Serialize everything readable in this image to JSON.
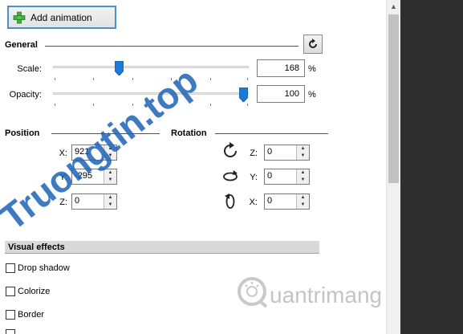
{
  "toolbar": {
    "add_animation_label": "Add animation"
  },
  "general": {
    "title": "General",
    "scale": {
      "label": "Scale:",
      "value": "168",
      "unit": "%",
      "slider_fraction": 0.34
    },
    "opacity": {
      "label": "Opacity:",
      "value": "100",
      "unit": "%",
      "slider_fraction": 1.0
    }
  },
  "position": {
    "title": "Position",
    "x": {
      "label": "X:",
      "value": "921"
    },
    "y": {
      "label": "Y:",
      "value": "-295"
    },
    "z": {
      "label": "Z:",
      "value": "0"
    }
  },
  "rotation": {
    "title": "Rotation",
    "z": {
      "label": "Z:",
      "value": "0"
    },
    "y": {
      "label": "Y:",
      "value": "0"
    },
    "x": {
      "label": "X:",
      "value": "0"
    }
  },
  "visual_effects": {
    "title": "Visual effects",
    "items": [
      {
        "label": "Drop shadow",
        "checked": false
      },
      {
        "label": "Colorize",
        "checked": false
      },
      {
        "label": "Border",
        "checked": false
      }
    ]
  },
  "watermarks": {
    "left": "Truongtin.top",
    "right": "uantrimang"
  },
  "colors": {
    "accent": "#4a90c8",
    "slider_thumb": "#1e7ad6",
    "watermark_red": "#e8393d",
    "watermark_blue": "#1c63b8"
  },
  "icons": {
    "add": "plus-icon",
    "reset": "reset-icon",
    "rot_z": "rotate-z-icon",
    "rot_y": "rotate-y-icon",
    "rot_x": "rotate-x-icon"
  }
}
